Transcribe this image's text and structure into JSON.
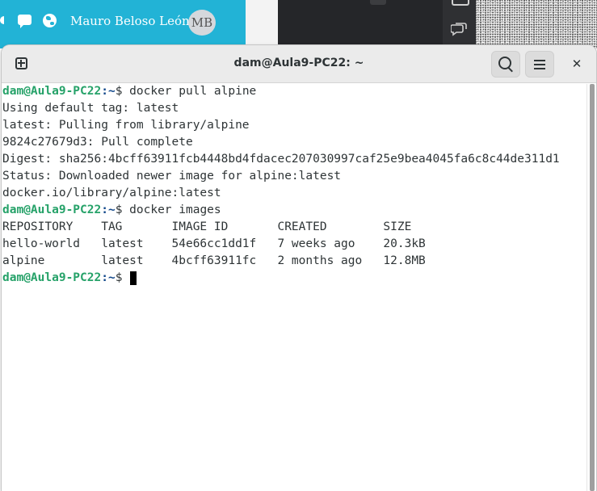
{
  "top_bar": {
    "user_name": "Mauro Beloso León",
    "avatar_initials": "MB",
    "accent_color": "#22b3d6"
  },
  "window": {
    "title": "dam@Aula9-PC22: ~"
  },
  "prompt": {
    "user_host": "dam@Aula9-PC22",
    "path": ":~",
    "symbol": "$"
  },
  "terminal": {
    "cmd1": " docker pull alpine",
    "out1": "Using default tag: latest",
    "out2": "latest: Pulling from library/alpine",
    "out3": "9824c27679d3: Pull complete",
    "out4": "Digest: sha256:4bcff63911fcb4448bd4fdacec207030997caf25e9bea4045fa6c8c44de311d1",
    "out5": "Status: Downloaded newer image for alpine:latest",
    "out6": "docker.io/library/alpine:latest",
    "cmd2": " docker images",
    "table_header": "REPOSITORY    TAG       IMAGE ID       CREATED        SIZE",
    "row1": "hello-world   latest    54e66cc1dd1f   7 weeks ago    20.3kB",
    "row2": "alpine        latest    4bcff63911fc   2 months ago   12.8MB",
    "cmd3": " "
  },
  "colors": {
    "prompt_user": "#26a269",
    "prompt_path": "#12488b"
  },
  "icons": [
    "notification-icon",
    "chat-icon",
    "globe-icon",
    "new-tab-icon",
    "search-icon",
    "menu-icon",
    "close-icon"
  ]
}
